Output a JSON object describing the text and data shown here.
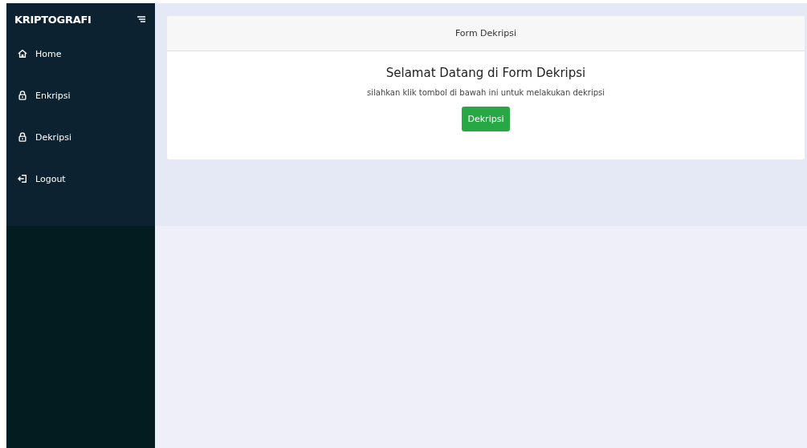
{
  "sidebar": {
    "brand": "KRIPTOGRAFI",
    "items": [
      {
        "label": "Home"
      },
      {
        "label": "Enkripsi"
      },
      {
        "label": "Dekripsi"
      },
      {
        "label": "Logout"
      }
    ]
  },
  "card": {
    "header": "Form Dekripsi",
    "title": "Selamat Datang di Form Dekripsi",
    "text": "silahkan klik tombol di bawah ini untuk melakukan dekripsi",
    "button": "Dekripsi"
  }
}
